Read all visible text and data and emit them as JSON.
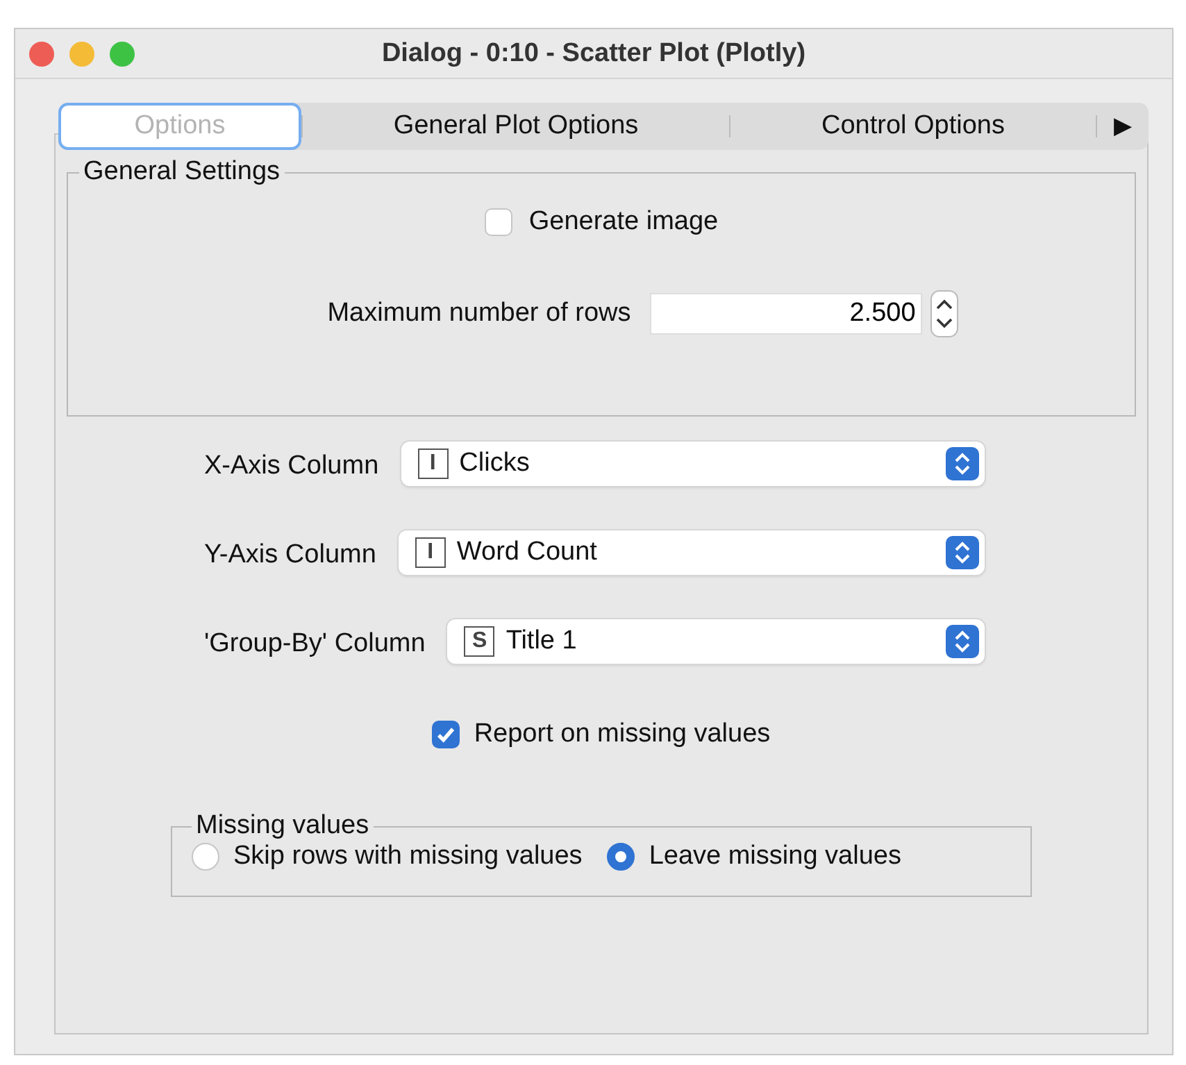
{
  "window": {
    "title": "Dialog - 0:10 - Scatter Plot (Plotly)"
  },
  "tabs": [
    {
      "label": "Options",
      "selected": true
    },
    {
      "label": "General Plot Options",
      "selected": false
    },
    {
      "label": "Control Options",
      "selected": false
    }
  ],
  "tab_scroll": "▶",
  "general_settings": {
    "title": "General Settings",
    "generate_image": {
      "label": "Generate image",
      "checked": false
    },
    "max_rows": {
      "label": "Maximum number of rows",
      "value": "2.500"
    }
  },
  "columns": [
    {
      "label": "X-Axis Column",
      "type_glyph": "I",
      "value": "Clicks"
    },
    {
      "label": "Y-Axis Column",
      "type_glyph": "I",
      "value": "Word Count"
    },
    {
      "label": "'Group-By' Column",
      "type_glyph": "S",
      "value": "Title 1"
    }
  ],
  "report_missing": {
    "label": "Report on missing values",
    "checked": true
  },
  "missing_values": {
    "title": "Missing values",
    "options": [
      {
        "label": "Skip rows with missing values",
        "selected": false
      },
      {
        "label": "Leave missing values",
        "selected": true
      }
    ]
  }
}
